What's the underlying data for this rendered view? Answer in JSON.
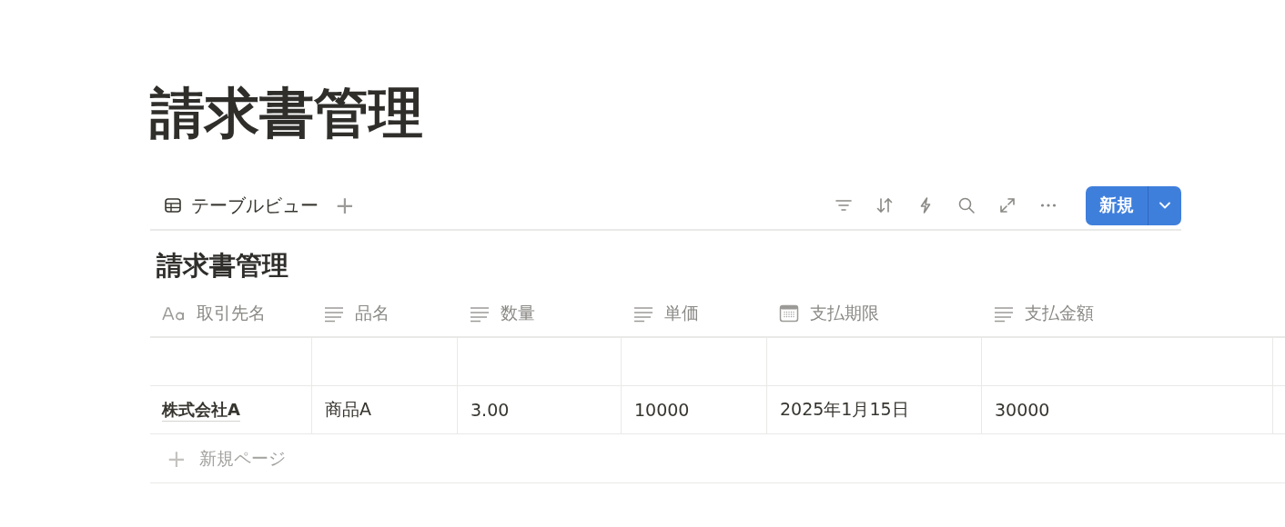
{
  "page_title": "請求書管理",
  "view_tabs": [
    {
      "label": "テーブルビュー",
      "selected": true
    }
  ],
  "add_view": "+",
  "new_button": {
    "label": "新規"
  },
  "table": {
    "title": "請求書管理",
    "columns": [
      {
        "label": "取引先名",
        "kind": "title"
      },
      {
        "label": "品名",
        "kind": "text"
      },
      {
        "label": "数量",
        "kind": "text"
      },
      {
        "label": "単価",
        "kind": "text"
      },
      {
        "label": "支払期限",
        "kind": "date"
      },
      {
        "label": "支払金額",
        "kind": "text"
      }
    ],
    "rows": [
      {
        "kind": "blank"
      },
      {
        "kind": "entry",
        "cells": [
          "株式会社A",
          "商品A",
          "3.00",
          "10000",
          "2025年1月15日",
          "30000"
        ]
      }
    ],
    "add_row": {
      "icon": "+",
      "label": "新規ページ"
    }
  }
}
